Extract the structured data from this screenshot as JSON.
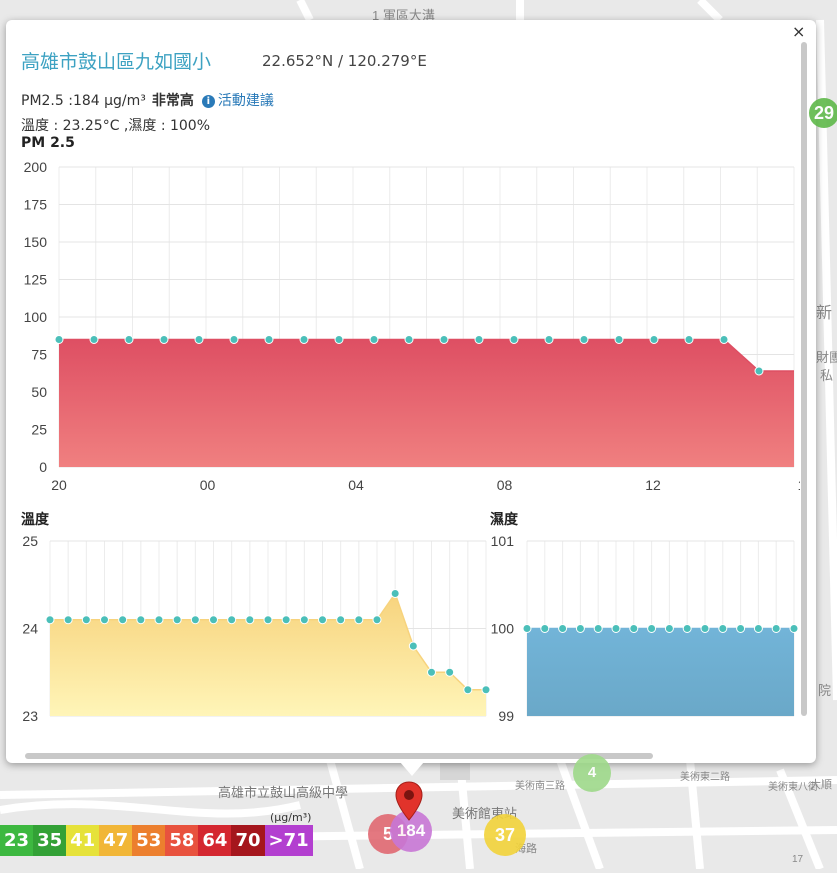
{
  "map": {
    "labels": [
      {
        "text": "1 軍區大溝",
        "cls": "road"
      },
      {
        "text": "高雄市立鼓山高級中學",
        "cls": "poi"
      },
      {
        "text": "美術館東站",
        "cls": "poi"
      },
      {
        "text": "美術南三路",
        "cls": "road"
      },
      {
        "text": "美術東二路",
        "cls": "road"
      },
      {
        "text": "美術東八街",
        "cls": "road"
      },
      {
        "text": "大順",
        "cls": "road"
      },
      {
        "text": "海路",
        "cls": "road"
      },
      {
        "text": "新",
        "cls": "road"
      },
      {
        "text": "財團",
        "cls": "road"
      },
      {
        "text": "私",
        "cls": "road"
      },
      {
        "text": "院",
        "cls": "road"
      },
      {
        "text": "17",
        "cls": "road"
      }
    ],
    "markers": [
      {
        "value": "29",
        "color": "#5fb94a"
      },
      {
        "value": "4",
        "color": "#9ed98a"
      },
      {
        "value": "5",
        "color": "#e0616b"
      },
      {
        "value": "184",
        "color": "#c877d6"
      },
      {
        "value": "37",
        "color": "#f2d33a"
      }
    ]
  },
  "popup": {
    "close_label": "×",
    "station_name": "高雄市鼓山區九如國小",
    "coordinates": "22.652°N / 120.279°E",
    "pm_text": "PM2.5 :184 μg/m³",
    "pm_level": "非常高",
    "info_icon": "i",
    "advice_link": "活動建議",
    "weather_text": "溫度 : 23.25°C ,濕度 : 100%"
  },
  "colors": {
    "pm_fill": "#f08080",
    "pm_line": "#de4f63",
    "temp_fill": "#fbe9a6",
    "temp_line": "#f7d37d",
    "hum_fill": "#72b4d8",
    "point": "#4bbfb9"
  },
  "chart_data": [
    {
      "type": "area",
      "title": "PM 2.5",
      "xlabel": "",
      "ylabel": "",
      "x_ticks": [
        "20",
        "00",
        "04",
        "08",
        "12",
        "1"
      ],
      "y_ticks": [
        0,
        25,
        50,
        75,
        100,
        125,
        150,
        175,
        200
      ],
      "ylim": [
        0,
        200
      ],
      "grid": true,
      "series": [
        {
          "values": [
            85,
            85,
            85,
            85,
            85,
            85,
            85,
            85,
            85,
            85,
            85,
            85,
            85,
            85,
            85,
            85,
            85,
            85,
            85,
            85,
            64,
            64
          ]
        }
      ]
    },
    {
      "type": "area",
      "title": "溫度",
      "xlabel": "",
      "ylabel": "",
      "y_ticks": [
        23,
        24,
        25
      ],
      "ylim": [
        23,
        25
      ],
      "grid": true,
      "series": [
        {
          "values": [
            24.1,
            24.1,
            24.1,
            24.1,
            24.1,
            24.1,
            24.1,
            24.1,
            24.1,
            24.1,
            24.1,
            24.1,
            24.1,
            24.1,
            24.1,
            24.1,
            24.1,
            24.1,
            24.1,
            24.4,
            23.8,
            23.5,
            23.5,
            23.3,
            23.3
          ]
        }
      ]
    },
    {
      "type": "area",
      "title": "濕度",
      "xlabel": "",
      "ylabel": "",
      "y_ticks": [
        99,
        100,
        101
      ],
      "ylim": [
        99,
        101
      ],
      "grid": true,
      "series": [
        {
          "values": [
            100,
            100,
            100,
            100,
            100,
            100,
            100,
            100,
            100,
            100,
            100,
            100,
            100,
            100,
            100,
            100
          ]
        }
      ]
    }
  ],
  "legend": {
    "unit": "(μg/m³)",
    "cells": [
      {
        "label": "23",
        "color": "#3db840"
      },
      {
        "label": "35",
        "color": "#33a136"
      },
      {
        "label": "41",
        "color": "#e6e23a"
      },
      {
        "label": "47",
        "color": "#f1b637"
      },
      {
        "label": "53",
        "color": "#ec7f2e"
      },
      {
        "label": "58",
        "color": "#e8523e"
      },
      {
        "label": "64",
        "color": "#d42730"
      },
      {
        "label": "70",
        "color": "#a5161d"
      },
      {
        "label": ">71",
        "color": "#b33fd0"
      }
    ]
  }
}
